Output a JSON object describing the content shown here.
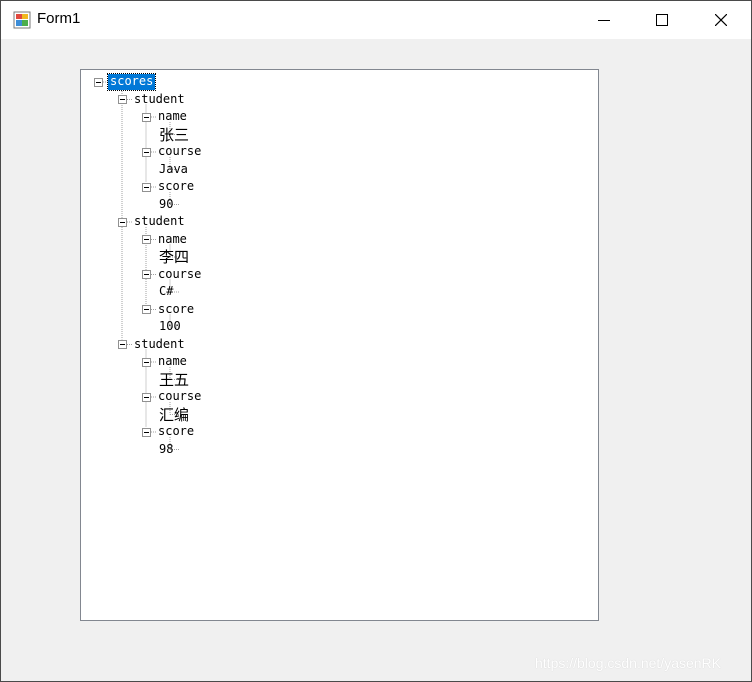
{
  "window": {
    "title": "Form1",
    "icons": {
      "app": "form-app-icon",
      "minimize": "minimize-icon",
      "maximize": "maximize-icon",
      "close": "close-icon"
    }
  },
  "tree": {
    "root": "scores",
    "students": [
      {
        "label": "student",
        "fields": [
          {
            "label": "name",
            "value": "张三"
          },
          {
            "label": "course",
            "value": "Java"
          },
          {
            "label": "score",
            "value": "90"
          }
        ]
      },
      {
        "label": "student",
        "fields": [
          {
            "label": "name",
            "value": "李四"
          },
          {
            "label": "course",
            "value": "C#"
          },
          {
            "label": "score",
            "value": "100"
          }
        ]
      },
      {
        "label": "student",
        "fields": [
          {
            "label": "name",
            "value": "王五"
          },
          {
            "label": "course",
            "value": "汇编"
          },
          {
            "label": "score",
            "value": "98"
          }
        ]
      }
    ],
    "selected_color": "#0078d7"
  },
  "watermark": "https://blog.csdn.net/yasenRK"
}
